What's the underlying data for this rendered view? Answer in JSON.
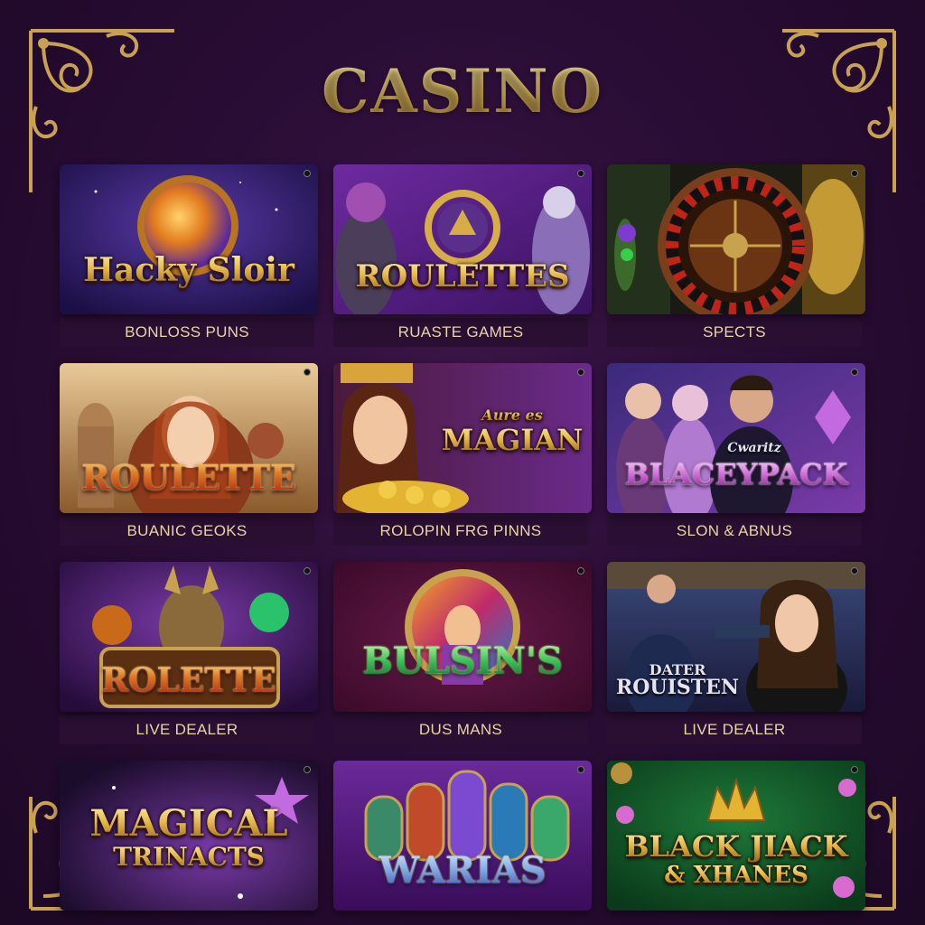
{
  "page_title": "CASINO",
  "colors": {
    "background": "#2a0d35",
    "gold": "#d8b359",
    "caption_bg": "#2a0f33",
    "caption_text": "#e9d4a6"
  },
  "games": [
    {
      "logo": "Hacky Sloir",
      "caption": "BONLOSS PUNS"
    },
    {
      "logo": "ROULETTES",
      "caption": "RUASTE GAMES"
    },
    {
      "logo": "",
      "caption": "SPECTS"
    },
    {
      "logo": "ROULETTE",
      "caption": "BUANIC GEOKS"
    },
    {
      "logo_top": "Aure es",
      "logo": "MAGIAN",
      "caption": "ROLOPIN FRG PINNS"
    },
    {
      "logo_top": "Cwaritz",
      "logo": "BLACEYPACK",
      "caption": "SLON & ABNUS"
    },
    {
      "logo": "ROLETTE",
      "caption": "LIVE DEALER"
    },
    {
      "logo": "BULSIN'S",
      "caption": "DUS MANS"
    },
    {
      "logo_top": "DATER",
      "logo": "ROUISTEN",
      "caption": "LIVE DEALER"
    },
    {
      "logo": "MAGICAL",
      "logo_bottom": "TRINACTS",
      "caption": ""
    },
    {
      "logo": "WARIAS",
      "caption": ""
    },
    {
      "logo": "BLACK JIACK",
      "logo_bottom": "& XHANES",
      "caption": ""
    }
  ]
}
